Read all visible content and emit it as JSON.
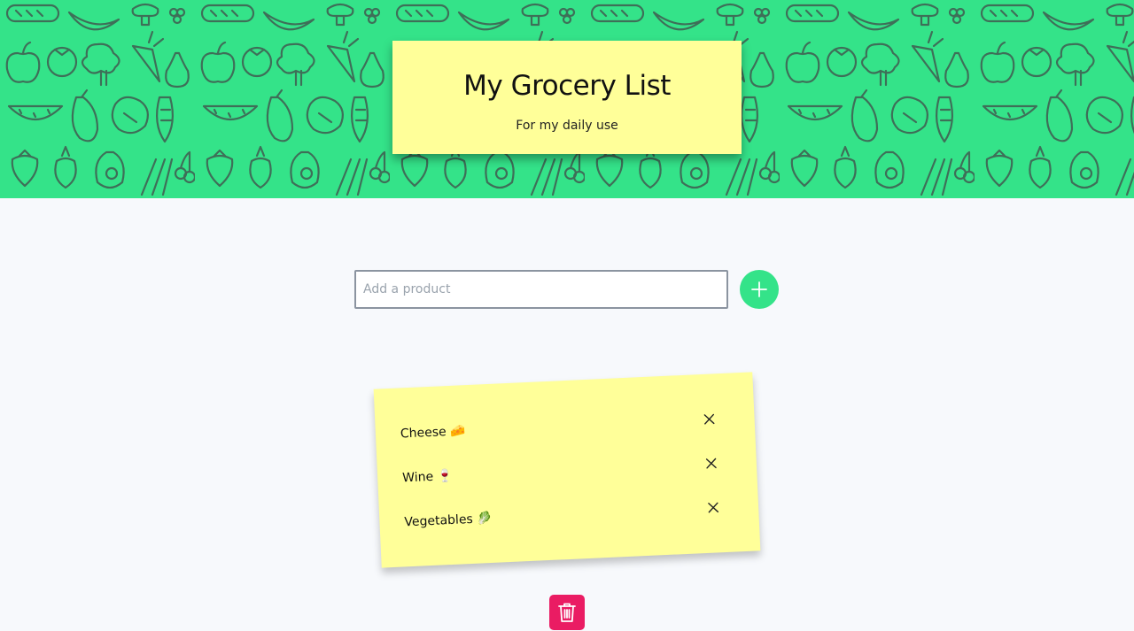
{
  "header": {
    "title": "My Grocery List",
    "subtitle": "For my daily use",
    "background_color": "#34e389",
    "pattern": "fruit-and-vegetable-line-icons"
  },
  "add_form": {
    "input_value": "",
    "input_placeholder": "Add a product",
    "add_button_icon": "plus-icon",
    "add_button_color": "#34e389"
  },
  "list": {
    "note_color": "#ffff99",
    "items": [
      {
        "label": "Cheese 🧀",
        "remove_icon": "close-icon"
      },
      {
        "label": "Wine 🍷",
        "remove_icon": "close-icon"
      },
      {
        "label": "Vegetables 🥬",
        "remove_icon": "close-icon"
      }
    ]
  },
  "footer": {
    "clear_button_icon": "trash-icon",
    "clear_button_color": "#ea1c63"
  }
}
